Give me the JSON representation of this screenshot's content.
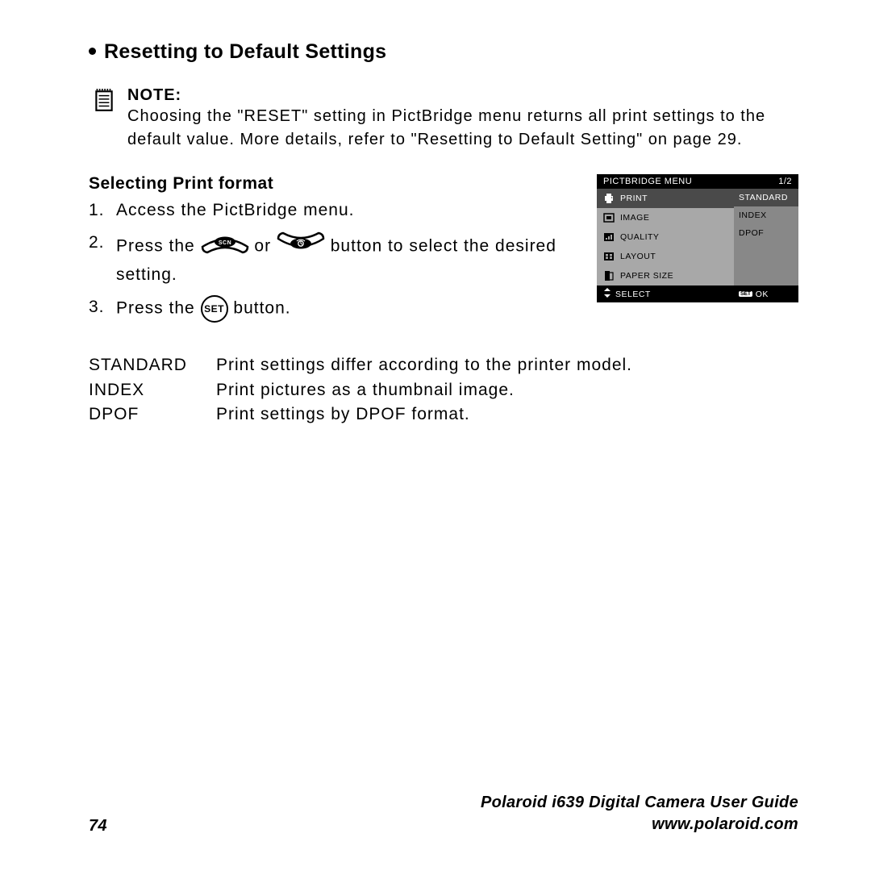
{
  "heading": "Resetting to Default Settings",
  "note": {
    "label": "NOTE:",
    "text": "Choosing the \"RESET\" setting in PictBridge menu returns all print settings to the default value. More details, refer to \"Resetting to Default Setting\" on page 29."
  },
  "sub_heading": "Selecting Print format",
  "steps": {
    "s1": {
      "num": "1.",
      "text": "Access the PictBridge menu."
    },
    "s2": {
      "num": "2.",
      "pre": "Press the ",
      "or": " or ",
      "post": " button to select the desired setting."
    },
    "s3": {
      "num": "3.",
      "pre": "Press the ",
      "set_label": "SET",
      "post": " button."
    }
  },
  "lcd": {
    "title": "PICTBRIDGE MENU",
    "page": "1/2",
    "left": [
      "PRINT",
      "IMAGE",
      "QUALITY",
      "LAYOUT",
      "PAPER SIZE"
    ],
    "right": [
      "STANDARD",
      "INDEX",
      "DPOF"
    ],
    "footer_select": "SELECT",
    "footer_ok": "OK",
    "set_badge": "SET"
  },
  "definitions": [
    {
      "term": "STANDARD",
      "desc": "Print settings differ according to the printer model."
    },
    {
      "term": "INDEX",
      "desc": "Print pictures as a thumbnail image."
    },
    {
      "term": "DPOF",
      "desc": "Print settings by DPOF format."
    }
  ],
  "footer": {
    "page_num": "74",
    "guide": "Polaroid i639 Digital Camera User Guide",
    "url": "www.polaroid.com"
  }
}
